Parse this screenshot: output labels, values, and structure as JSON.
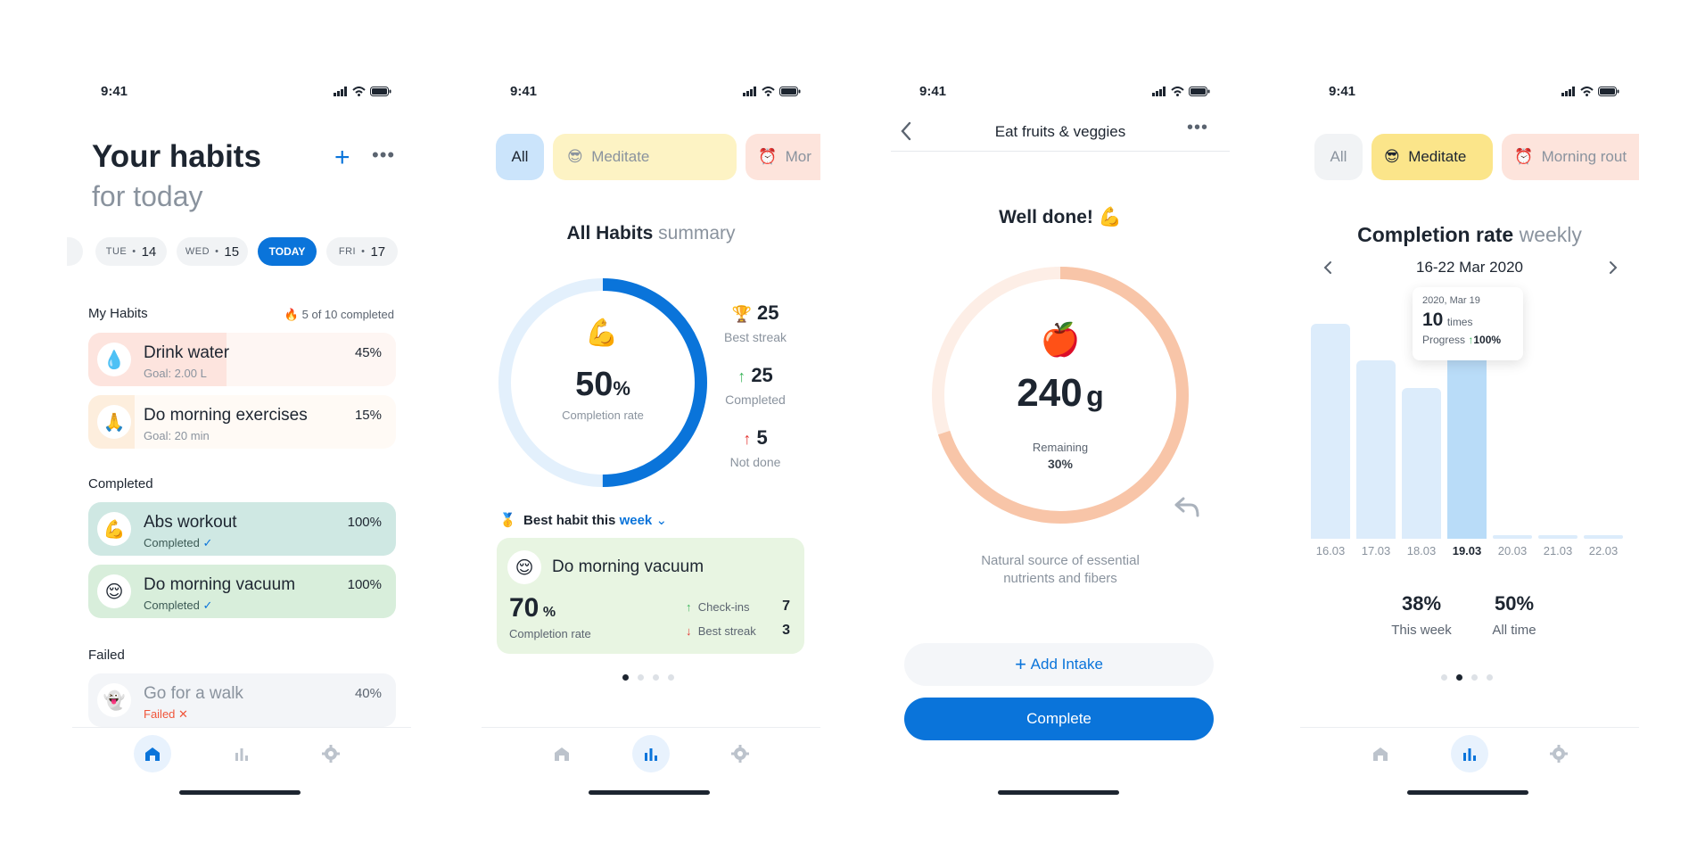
{
  "status": {
    "time": "9:41"
  },
  "screen1": {
    "title": "Your habits",
    "subtitle": "for today",
    "days": [
      {
        "dow": "TUE",
        "num": "14"
      },
      {
        "dow": "WED",
        "num": "15"
      },
      {
        "label": "TODAY"
      },
      {
        "dow": "FRI",
        "num": "17"
      }
    ],
    "my_habits_label": "My Habits",
    "completed_count": "5 of 10 completed",
    "habits": [
      {
        "icon": "💧",
        "name": "Drink water",
        "goal": "Goal: 2.00 L",
        "pct": "45%",
        "progress": 0.45,
        "color": "#fde4de"
      },
      {
        "icon": "🙏",
        "name": "Do morning exercises",
        "goal": "Goal: 20 min",
        "pct": "15%",
        "progress": 0.15,
        "color": "#fdeedd"
      }
    ],
    "completed_label": "Completed",
    "completed": [
      {
        "icon": "💪",
        "name": "Abs workout",
        "status": "Completed",
        "pct": "100%",
        "color": "#cfe8e3"
      },
      {
        "icon": "😌",
        "name": "Do morning vacuum",
        "status": "Completed",
        "pct": "100%",
        "color": "#d8eedb"
      }
    ],
    "failed_label": "Failed",
    "failed": [
      {
        "icon": "👻",
        "name": "Go for a walk",
        "status": "Failed",
        "pct": "40%"
      }
    ]
  },
  "screen2": {
    "chips": [
      "All",
      "Meditate",
      "Mor"
    ],
    "chip_icons": [
      "😎",
      "⏰"
    ],
    "title_bold": "All Habits",
    "title_light": "summary",
    "ring_value": "50",
    "ring_unit": "%",
    "ring_label": "Completion rate",
    "ring_progress": 0.5,
    "ring_icon": "💪",
    "stats": [
      {
        "icon": "🏆",
        "value": "25",
        "label": "Best streak"
      },
      {
        "icon": "↑",
        "value": "25",
        "label": "Completed"
      },
      {
        "icon": "↑",
        "value": "5",
        "label": "Not done"
      }
    ],
    "best_habit_prefix": "Best habit this",
    "best_habit_period": "week",
    "best_icon": "🥇",
    "card": {
      "icon": "😌",
      "name": "Do morning vacuum",
      "rate": "70",
      "rate_unit": "%",
      "rate_label": "Completion rate",
      "checkins_label": "Check-ins",
      "checkins": "7",
      "streak_label": "Best streak",
      "streak": "3"
    }
  },
  "screen3": {
    "title": "Eat fruits & veggies",
    "headline": "Well done! 💪",
    "ring_icon": "🍎",
    "value": "240",
    "unit": "g",
    "remaining_label": "Remaining",
    "remaining": "30%",
    "ring_progress": 0.7,
    "description_line1": "Natural source of essential",
    "description_line2": "nutrients and fibers",
    "add_intake": "Add Intake",
    "complete": "Complete"
  },
  "screen4": {
    "chips": [
      "All",
      "Meditate",
      "Morning rout"
    ],
    "chip_icons": [
      "😎",
      "⏰"
    ],
    "title_bold": "Completion rate",
    "title_light": "weekly",
    "range": "16-22 Mar 2020",
    "tooltip": {
      "date": "2020, Mar 19",
      "value": "10",
      "unit": "times",
      "progress_label": "Progress",
      "progress": "100%"
    },
    "chart_data": {
      "type": "bar",
      "categories": [
        "16.03",
        "17.03",
        "18.03",
        "19.03",
        "20.03",
        "21.03",
        "22.03"
      ],
      "values": [
        100,
        83,
        70,
        100,
        0,
        0,
        0
      ],
      "highlight": "19.03"
    },
    "summary": [
      {
        "value": "38%",
        "label": "This week"
      },
      {
        "value": "50%",
        "label": "All time"
      }
    ]
  }
}
